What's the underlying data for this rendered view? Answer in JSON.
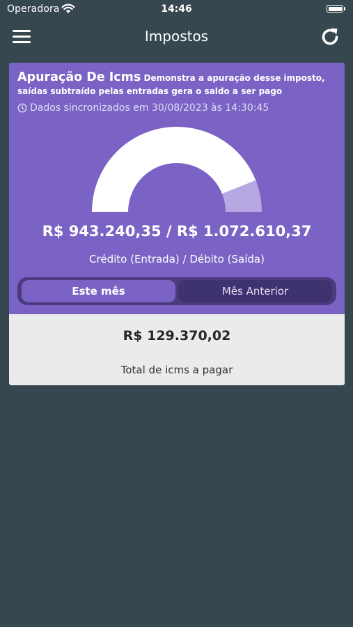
{
  "status_bar": {
    "carrier": "Operadora",
    "time": "14:46"
  },
  "app_bar": {
    "title": "Impostos"
  },
  "card": {
    "title": "Apuração De Icms",
    "description": "Demonstra a apuração desse imposto, saídas subtraído pelas entradas gera o saldo a ser pago",
    "sync_text": "Dados sincronizados em 30/08/2023 às 14:30:45",
    "gauge": {
      "credit": 943240.35,
      "debit": 1072610.37,
      "fill_color": "#ffffff",
      "remainder_color": "#b7a8e3"
    },
    "amounts_text": "R$ 943.240,35 / R$ 1.072.610,37",
    "amounts_label": "Crédito (Entrada) / Débito (Saída)",
    "toggle": {
      "options": [
        "Este mês",
        "Mês Anterior"
      ],
      "selected": "Este mês"
    },
    "total_value": "R$ 129.370,02",
    "total_label": "Total de icms a pagar"
  },
  "colors": {
    "background": "#37474f",
    "accent": "#7b63c5",
    "panel": "#ebebeb"
  }
}
